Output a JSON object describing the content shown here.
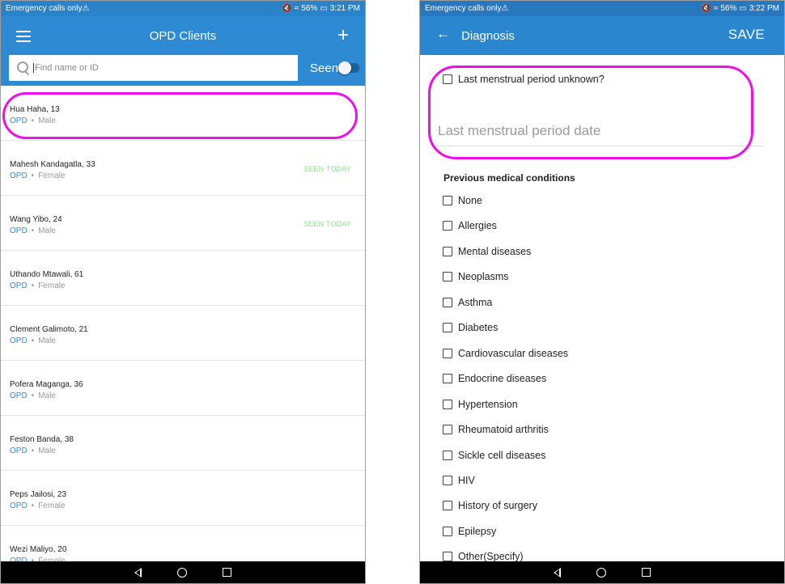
{
  "left_screen": {
    "status": {
      "left_text": "Emergency calls only",
      "time": "3:21 PM",
      "battery": "56%"
    },
    "header": {
      "title": "OPD Clients",
      "add_icon": "plus-icon",
      "menu_icon": "hamburger-icon"
    },
    "search": {
      "placeholder": "Find name or ID",
      "value": ""
    },
    "seen_toggle": {
      "label": "Seen",
      "state": "off"
    },
    "clients": [
      {
        "name": "Hua Haha, 13",
        "type": "OPD",
        "gender": "Male",
        "status": ""
      },
      {
        "name": "Mahesh Kandagatla, 33",
        "type": "OPD",
        "gender": "Female",
        "status": "SEEN TODAY"
      },
      {
        "name": "Wang Yibo, 24",
        "type": "OPD",
        "gender": "Male",
        "status": "SEEN TODAY"
      },
      {
        "name": "Uthando Mtawali, 61",
        "type": "OPD",
        "gender": "Female",
        "status": ""
      },
      {
        "name": "Clement Galimoto, 21",
        "type": "OPD",
        "gender": "Male",
        "status": ""
      },
      {
        "name": "Pofera Maganga, 36",
        "type": "OPD",
        "gender": "Male",
        "status": ""
      },
      {
        "name": "Feston Banda, 38",
        "type": "OPD",
        "gender": "Male",
        "status": ""
      },
      {
        "name": "Peps Jailosi, 23",
        "type": "OPD",
        "gender": "Female",
        "status": ""
      },
      {
        "name": "Wezi Maliyo, 20",
        "type": "OPD",
        "gender": "Female",
        "status": ""
      }
    ],
    "separator": "•"
  },
  "right_screen": {
    "status": {
      "left_text": "Emergency calls only",
      "time": "3:22 PM",
      "battery": "56%"
    },
    "header": {
      "title": "Diagnosis",
      "save_label": "SAVE",
      "back_icon": "arrow-left-icon"
    },
    "lmp_unknown_label": "Last menstrual period unknown?",
    "lmp_date_placeholder": "Last menstrual period date",
    "conditions_title": "Previous medical conditions",
    "conditions": [
      "None",
      "Allergies",
      "Mental diseases",
      "Neoplasms",
      "Asthma",
      "Diabetes",
      "Cardiovascular diseases",
      "Endocrine diseases",
      "Hypertension",
      "Rheumatoid arthritis",
      "Sickle cell diseases",
      "HIV",
      "History of surgery",
      "Epilepsy",
      "Other(Specify)"
    ]
  },
  "colors": {
    "app_bar": "#2d8ad3",
    "highlight": "#ee0ee8",
    "seen_today": "#8fe28f",
    "opd_label": "#2b8fd6"
  }
}
